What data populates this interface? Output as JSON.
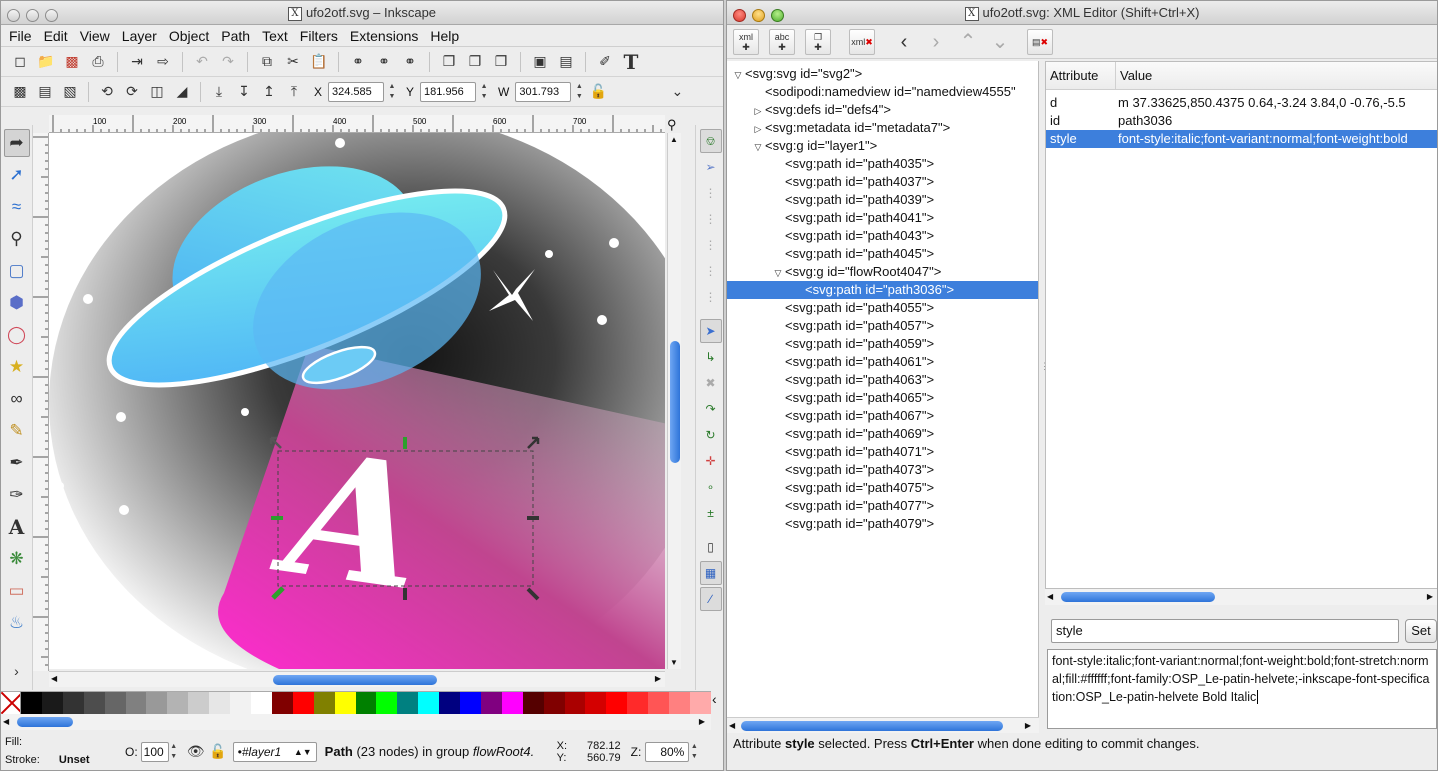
{
  "inkscape": {
    "title": "ufo2otf.svg – Inkscape",
    "menus": [
      "File",
      "Edit",
      "View",
      "Layer",
      "Object",
      "Path",
      "Text",
      "Filters",
      "Extensions",
      "Help"
    ],
    "coords": {
      "x_label": "X",
      "x_value": "324.585",
      "y_label": "Y",
      "y_value": "181.956",
      "w_label": "W",
      "w_value": "301.793"
    },
    "ruler_marks": [
      "100",
      "200",
      "300",
      "400",
      "500",
      "600",
      "700"
    ],
    "canvas_letter": "A",
    "palette_colors": [
      "#000000",
      "#1a1a1a",
      "#333333",
      "#4d4d4d",
      "#666666",
      "#808080",
      "#999999",
      "#b3b3b3",
      "#cccccc",
      "#e6e6e6",
      "#f2f2f2",
      "#ffffff",
      "#800000",
      "#ff0000",
      "#808000",
      "#ffff00",
      "#008000",
      "#00ff00",
      "#008080",
      "#00ffff",
      "#000080",
      "#0000ff",
      "#800080",
      "#ff00ff",
      "#550000",
      "#800000",
      "#aa0000",
      "#d40000",
      "#ff0000",
      "#ff2a2a",
      "#ff5555",
      "#ff8080",
      "#ffaaaa"
    ],
    "status": {
      "fill_label": "Fill:",
      "stroke_label": "Stroke:",
      "stroke_value": "Unset",
      "opacity_label": "O:",
      "opacity_value": "100",
      "layer_value": "•#layer1",
      "message_strong": "Path",
      "message": " (23 nodes) in group ",
      "message_em": "flowRoot4.",
      "cursor_x_label": "X:",
      "cursor_x": "782.12",
      "cursor_y_label": "Y:",
      "cursor_y": "560.79",
      "zoom_label": "Z:",
      "zoom_value": "80%"
    }
  },
  "xml_editor": {
    "title": "ufo2otf.svg: XML Editor (Shift+Ctrl+X)",
    "toolbar_icons": [
      "new-element-node-icon",
      "new-text-node-icon",
      "duplicate-node-icon",
      "delete-node-icon",
      "unindent-icon",
      "indent-icon",
      "raise-icon",
      "lower-icon",
      "delete-attribute-icon"
    ],
    "tree": [
      {
        "text": "<svg:svg id=\"svg2\">",
        "depth": 0,
        "toggle": "open"
      },
      {
        "text": "<sodipodi:namedview id=\"namedview4555\"",
        "depth": 1,
        "toggle": ""
      },
      {
        "text": "<svg:defs id=\"defs4\">",
        "depth": 1,
        "toggle": "closed"
      },
      {
        "text": "<svg:metadata id=\"metadata7\">",
        "depth": 1,
        "toggle": "closed"
      },
      {
        "text": "<svg:g id=\"layer1\">",
        "depth": 1,
        "toggle": "open"
      },
      {
        "text": "<svg:path id=\"path4035\">",
        "depth": 2,
        "toggle": ""
      },
      {
        "text": "<svg:path id=\"path4037\">",
        "depth": 2,
        "toggle": ""
      },
      {
        "text": "<svg:path id=\"path4039\">",
        "depth": 2,
        "toggle": ""
      },
      {
        "text": "<svg:path id=\"path4041\">",
        "depth": 2,
        "toggle": ""
      },
      {
        "text": "<svg:path id=\"path4043\">",
        "depth": 2,
        "toggle": ""
      },
      {
        "text": "<svg:path id=\"path4045\">",
        "depth": 2,
        "toggle": ""
      },
      {
        "text": "<svg:g id=\"flowRoot4047\">",
        "depth": 2,
        "toggle": "open"
      },
      {
        "text": "<svg:path id=\"path3036\">",
        "depth": 3,
        "toggle": "",
        "selected": true
      },
      {
        "text": "<svg:path id=\"path4055\">",
        "depth": 2,
        "toggle": ""
      },
      {
        "text": "<svg:path id=\"path4057\">",
        "depth": 2,
        "toggle": ""
      },
      {
        "text": "<svg:path id=\"path4059\">",
        "depth": 2,
        "toggle": ""
      },
      {
        "text": "<svg:path id=\"path4061\">",
        "depth": 2,
        "toggle": ""
      },
      {
        "text": "<svg:path id=\"path4063\">",
        "depth": 2,
        "toggle": ""
      },
      {
        "text": "<svg:path id=\"path4065\">",
        "depth": 2,
        "toggle": ""
      },
      {
        "text": "<svg:path id=\"path4067\">",
        "depth": 2,
        "toggle": ""
      },
      {
        "text": "<svg:path id=\"path4069\">",
        "depth": 2,
        "toggle": ""
      },
      {
        "text": "<svg:path id=\"path4071\">",
        "depth": 2,
        "toggle": ""
      },
      {
        "text": "<svg:path id=\"path4073\">",
        "depth": 2,
        "toggle": ""
      },
      {
        "text": "<svg:path id=\"path4075\">",
        "depth": 2,
        "toggle": ""
      },
      {
        "text": "<svg:path id=\"path4077\">",
        "depth": 2,
        "toggle": ""
      },
      {
        "text": "<svg:path id=\"path4079\">",
        "depth": 2,
        "toggle": ""
      }
    ],
    "attr_header": {
      "attribute": "Attribute",
      "value": "Value"
    },
    "attributes": [
      {
        "name": "d",
        "value": "m 37.33625,850.4375 0.64,-3.24 3.84,0 -0.76,-5.5"
      },
      {
        "name": "id",
        "value": "path3036"
      },
      {
        "name": "style",
        "value": "font-style:italic;font-variant:normal;font-weight:bold",
        "selected": true
      }
    ],
    "attr_name_input": "style",
    "set_label": "Set",
    "attr_value_text": "font-style:italic;font-variant:normal;font-weight:bold;font-stretch:normal;fill:#ffffff;font-family:OSP_Le-patin-helvete;-inkscape-font-specification:OSP_Le-patin-helvete Bold Italic",
    "status": {
      "pre": "Attribute ",
      "strong1": "style",
      "mid": " selected. Press ",
      "strong2": "Ctrl+Enter",
      "post": " when done editing to commit changes."
    }
  }
}
